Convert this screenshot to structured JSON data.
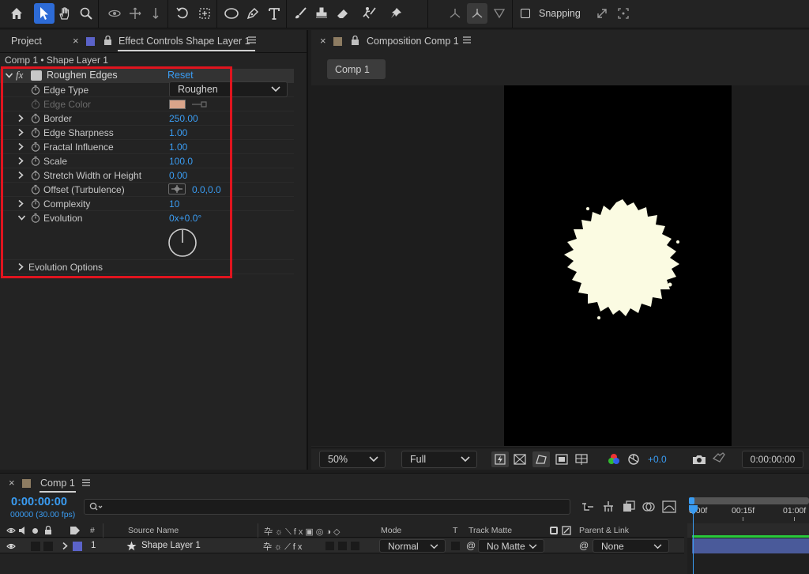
{
  "toolbar": {
    "tools": [
      "home-icon",
      "selection-tool-icon",
      "hand-tool-icon",
      "zoom-tool-icon",
      "orbit-camera-icon",
      "pan-camera-icon",
      "dolly-camera-icon",
      "rotation-tool-icon",
      "pan-behind-icon",
      "ellipse-tool-icon",
      "pen-tool-icon",
      "type-tool-icon",
      "brush-tool-icon",
      "clone-stamp-icon",
      "eraser-tool-icon",
      "roto-brush-icon",
      "puppet-pin-icon"
    ],
    "snapping_label": "Snapping",
    "accent_color": "#2d6bd6"
  },
  "left_panel": {
    "tabs": {
      "project": "Project",
      "effect_controls": "Effect Controls Shape Layer 1"
    },
    "breadcrumb": "Comp 1 • Shape Layer 1",
    "effect": {
      "fx_label": "fx",
      "name": "Roughen Edges",
      "reset_label": "Reset",
      "edge_type": {
        "label": "Edge Type",
        "value": "Roughen"
      },
      "edge_color": {
        "label": "Edge Color",
        "swatch": "#d9a48a"
      },
      "properties": [
        {
          "label": "Border",
          "value": "250.00"
        },
        {
          "label": "Edge Sharpness",
          "value": "1.00"
        },
        {
          "label": "Fractal Influence",
          "value": "1.00"
        },
        {
          "label": "Scale",
          "value": "100.0"
        },
        {
          "label": "Stretch Width or Height",
          "value": "0.00"
        }
      ],
      "offset": {
        "label": "Offset (Turbulence)",
        "value": "0.0,0.0"
      },
      "complexity": {
        "label": "Complexity",
        "value": "10"
      },
      "evolution": {
        "label": "Evolution",
        "value": "0x+0.0°"
      },
      "evolution_options": "Evolution Options"
    },
    "highlight_color": "#e0141e"
  },
  "composition": {
    "tab_label": "Composition Comp 1",
    "sub_tab": "Comp 1",
    "zoom": "50%",
    "resolution": "Full",
    "exposure": "+0.0",
    "timecode": "0:00:00:00",
    "shape_color": "#fbfbe2"
  },
  "timeline": {
    "tab_label": "Comp 1",
    "current_time": "0:00:00:00",
    "frame_info": "00000 (30.00 fps)",
    "search_placeholder": "",
    "columns": {
      "source_name": "Source Name",
      "hash": "#",
      "mode": "Mode",
      "t": "T",
      "track_matte": "Track Matte",
      "parent": "Parent & Link"
    },
    "ruler": [
      "0:00f",
      "00:15f",
      "01:00f"
    ],
    "layer": {
      "index": "1",
      "name": "Shape Layer 1",
      "mode": "Normal",
      "matte": "No Matte",
      "parent": "None",
      "label_color": "#5b63c9"
    }
  }
}
